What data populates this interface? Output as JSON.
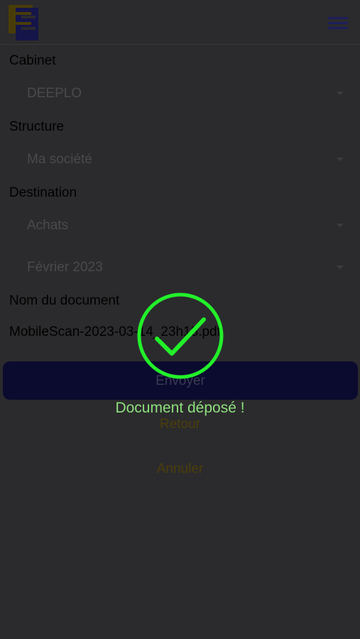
{
  "header": {
    "logo_icon": "company-logo-icon",
    "menu_icon": "hamburger-menu-icon"
  },
  "form": {
    "cabinet": {
      "label": "Cabinet",
      "value": "DEEPLO"
    },
    "structure": {
      "label": "Structure",
      "value": "Ma société"
    },
    "destination": {
      "label": "Destination",
      "value": "Achats"
    },
    "period": {
      "value": "Février 2023"
    },
    "document": {
      "label": "Nom du document",
      "value": "MobileScan-2023-03-14_23h13.pdf"
    }
  },
  "actions": {
    "send_label": "Envoyer",
    "back_label": "Retour",
    "cancel_label": "Annuler"
  },
  "overlay": {
    "icon": "check-circle-icon",
    "message": "Document déposé !",
    "color": "#22f02a"
  },
  "colors": {
    "background_dim": "#2b2b2d",
    "primary_button": "#0b0a2f",
    "link": "#4c3e0a",
    "success_text": "#8ee07e"
  }
}
